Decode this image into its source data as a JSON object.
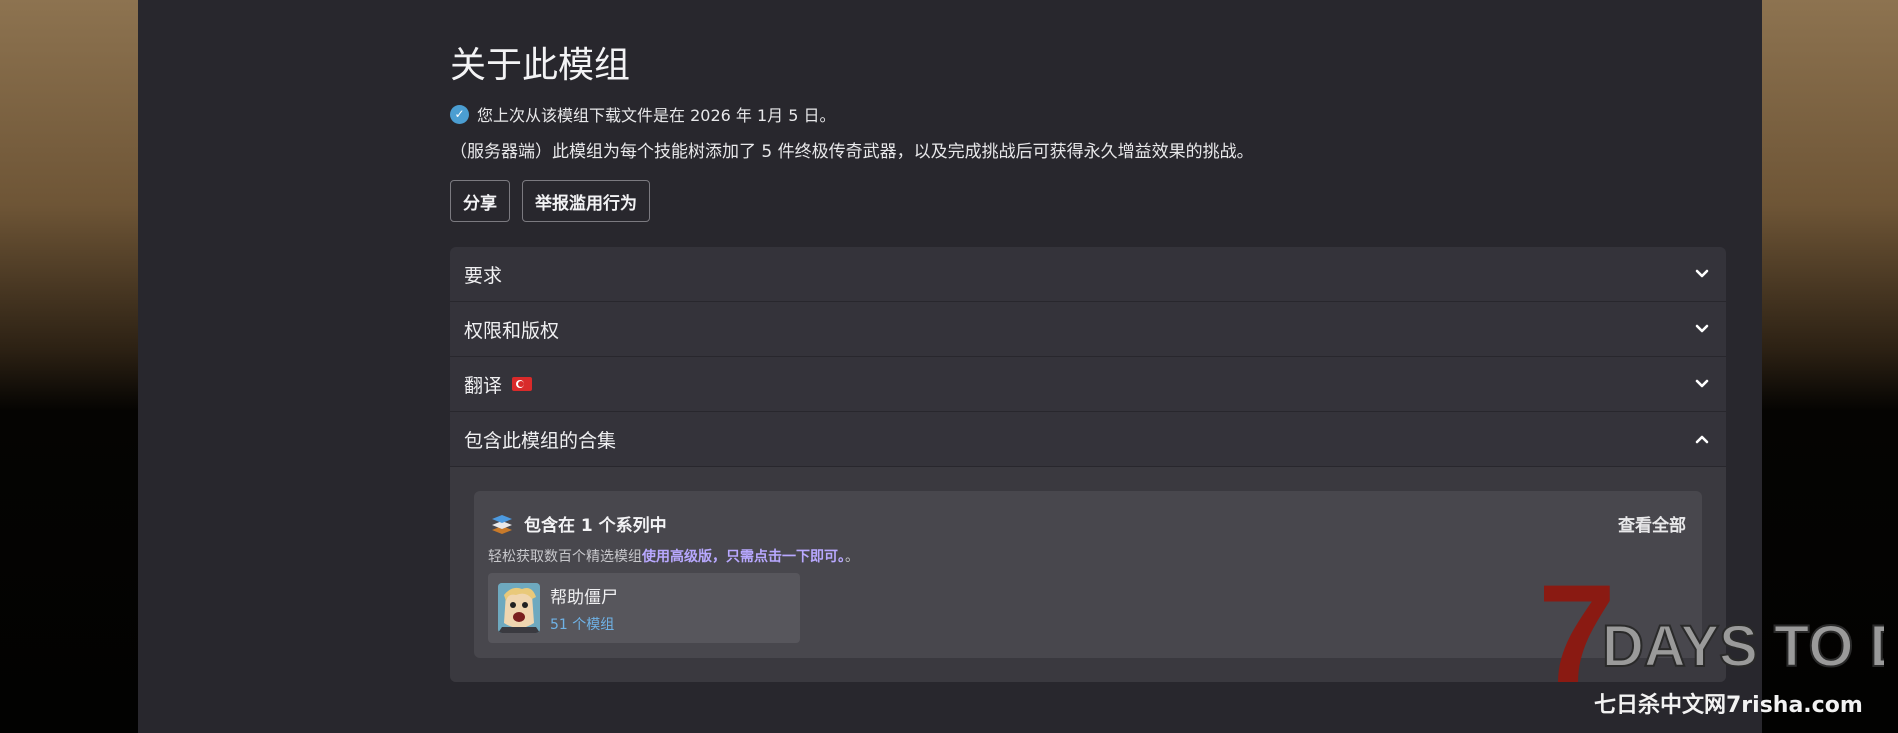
{
  "page": {
    "title": "关于此模组",
    "last_download": "您上次从该模组下载文件是在 2026 年 1月 5 日。",
    "description": "（服务器端）此模组为每个技能树添加了 5 件终极传奇武器，以及完成挑战后可获得永久增益效果的挑战。"
  },
  "buttons": {
    "share": "分享",
    "report": "举报滥用行为"
  },
  "accordion": [
    {
      "label": "要求",
      "expanded": false
    },
    {
      "label": "权限和版权",
      "expanded": false
    },
    {
      "label": "翻译",
      "expanded": false,
      "flag": "turkey-flag"
    },
    {
      "label": "包含此模组的合集",
      "expanded": true
    }
  ],
  "collections": {
    "title": "包含在 1 个系列中",
    "view_all": "查看全部",
    "subtitle_plain": "轻松获取数百个精选模组",
    "subtitle_highlight": "使用高级版，只需点击一下即可。",
    "subtitle_tail": "。",
    "items": [
      {
        "name": "帮助僵尸",
        "count": "51 个模组"
      }
    ]
  },
  "watermark": {
    "brand": "DAYS TO DIE",
    "numeral": "7",
    "site": "七日杀中文网7risha.com"
  },
  "colors": {
    "panel_bg": "#28272d",
    "accordion_bg": "#34333a",
    "card_bg": "#48474d",
    "link_blue": "#6fb2e6",
    "highlight_purple": "#b8a8ff",
    "check_blue": "#4b9ed2"
  }
}
